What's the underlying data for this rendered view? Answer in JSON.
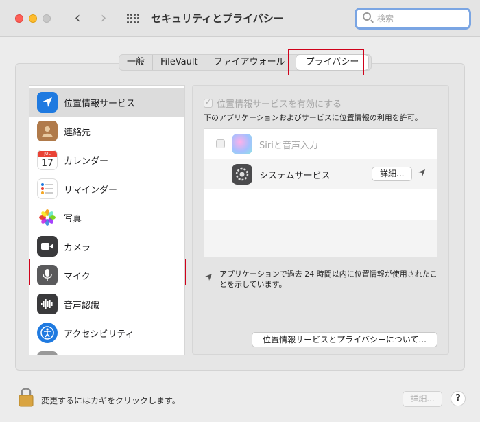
{
  "window": {
    "title": "セキュリティとプライバシー",
    "search_placeholder": "検索"
  },
  "tabs": [
    {
      "label": "一般",
      "active": false
    },
    {
      "label": "FileVault",
      "active": false
    },
    {
      "label": "ファイアウォール",
      "active": false
    },
    {
      "label": "プライバシー",
      "active": true
    }
  ],
  "sidebar": {
    "items": [
      {
        "label": "位置情報サービス",
        "icon": "location-icon",
        "selected": true
      },
      {
        "label": "連絡先",
        "icon": "contacts-icon",
        "selected": false
      },
      {
        "label": "カレンダー",
        "icon": "calendar-icon",
        "selected": false,
        "icon_text_top": "JUL",
        "icon_text_day": "17"
      },
      {
        "label": "リマインダー",
        "icon": "reminders-icon",
        "selected": false
      },
      {
        "label": "写真",
        "icon": "photos-icon",
        "selected": false
      },
      {
        "label": "カメラ",
        "icon": "camera-icon",
        "selected": false
      },
      {
        "label": "マイク",
        "icon": "microphone-icon",
        "selected": false
      },
      {
        "label": "音声認識",
        "icon": "speech-recognition-icon",
        "selected": false
      },
      {
        "label": "アクセシビリティ",
        "icon": "accessibility-icon",
        "selected": false
      }
    ]
  },
  "location": {
    "enable_label": "位置情報サービスを有効にする",
    "enable_checked": true,
    "description": "下のアプリケーションおよびサービスに位置情報の利用を許可。",
    "apps": [
      {
        "name": "Siriと音声入力",
        "checked": false,
        "icon": "siri-icon",
        "disabled": true
      },
      {
        "name": "システムサービス",
        "icon": "system-services-icon",
        "detail_label": "詳細...",
        "location_used": true
      }
    ],
    "note": "アプリケーションで過去 24 時間以内に位置情報が使用されたことを示しています。",
    "about_button": "位置情報サービスとプライバシーについて..."
  },
  "footer": {
    "lock_text": "変更するにはカギをクリックします。",
    "detail_button": "詳細...",
    "help": "?"
  },
  "colors": {
    "highlight": "#d0021b",
    "location_blue": "#1f7ae0",
    "search_border": "#7aa5e3"
  }
}
